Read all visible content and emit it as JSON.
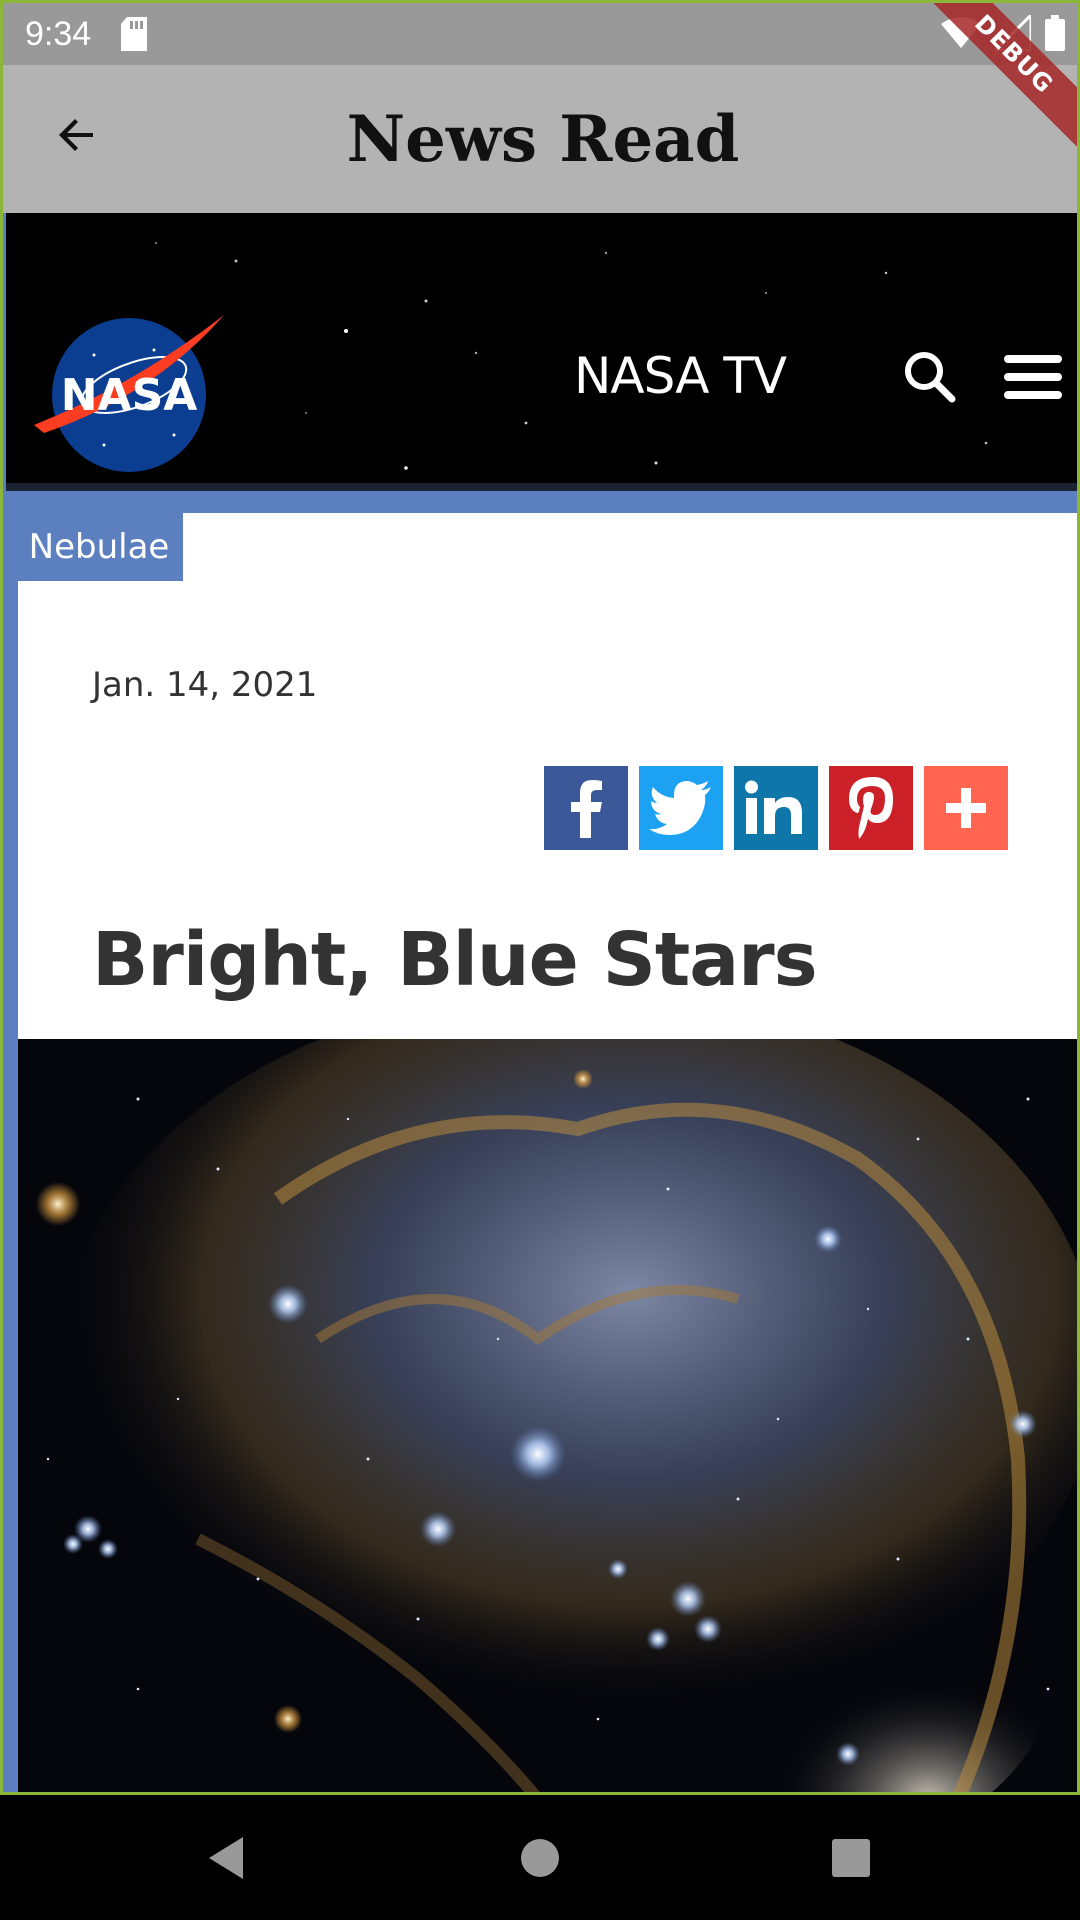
{
  "status_bar": {
    "time": "9:34",
    "icons": [
      "sd-card-icon",
      "wifi-icon",
      "signal-icon",
      "battery-icon"
    ],
    "debug_label": "DEBUG"
  },
  "app_bar": {
    "title": "News Read",
    "back_icon": "arrow-back-icon"
  },
  "site_header": {
    "logo_text": "NASA",
    "nav_label": "NASA TV",
    "icons": [
      "search-icon",
      "hamburger-menu-icon"
    ]
  },
  "article": {
    "category": "Nebulae",
    "date": "Jan. 14, 2021",
    "title": "Bright, Blue Stars",
    "share_buttons": [
      {
        "name": "facebook",
        "icon": "facebook-icon",
        "color": "#3b5998"
      },
      {
        "name": "twitter",
        "icon": "twitter-icon",
        "color": "#1da1f2"
      },
      {
        "name": "linkedin",
        "icon": "linkedin-icon",
        "color": "#0e76a8"
      },
      {
        "name": "pinterest",
        "icon": "pinterest-icon",
        "color": "#cb2027"
      },
      {
        "name": "more",
        "icon": "plus-icon",
        "color": "#ff6550"
      }
    ]
  },
  "nav_bar": {
    "icons": [
      "back-triangle-icon",
      "home-circle-icon",
      "recents-square-icon"
    ]
  },
  "colors": {
    "accent_blue": "#5b7fbf",
    "app_bar_gray": "#b3b3b3",
    "status_bar_gray": "#999999",
    "frame_green": "#8bb63a"
  }
}
